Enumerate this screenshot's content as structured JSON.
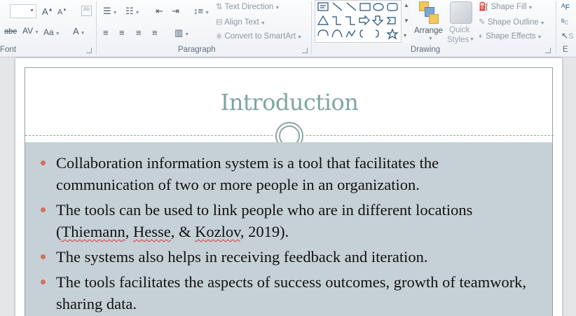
{
  "ribbon": {
    "groups": {
      "font": "Font",
      "paragraph": "Paragraph",
      "drawing": "Drawing"
    },
    "paragraph_buttons": {
      "text_direction": "Text Direction",
      "align_text": "Align Text",
      "convert_smartart": "Convert to SmartArt"
    },
    "drawing_buttons": {
      "arrange": "Arrange",
      "quick_styles_line1": "Quick",
      "quick_styles_line2": "Styles",
      "shape_fill": "Shape Fill",
      "shape_outline": "Shape Outline",
      "shape_effects": "Shape Effects"
    },
    "editing_partial": {
      "e_label": "E",
      "f_label": "F",
      "s_label": "S"
    }
  },
  "slide": {
    "title": "Introduction",
    "bullets": [
      {
        "parts": [
          {
            "t": "Collaboration information system is a tool that facilitates  the communication of two or more people in an organization."
          }
        ]
      },
      {
        "parts": [
          {
            "t": "The tools can be used to link  people who are in different locations ("
          },
          {
            "t": "Thiemann",
            "sq": true
          },
          {
            "t": ", "
          },
          {
            "t": "Hesse",
            "sq": true
          },
          {
            "t": ", & "
          },
          {
            "t": "Kozlov",
            "sq": true
          },
          {
            "t": ",  2019)."
          }
        ]
      },
      {
        "parts": [
          {
            "t": "The systems also helps in receiving  feedback and iteration."
          }
        ]
      },
      {
        "parts": [
          {
            "t": "The tools facilitates  the aspects of success outcomes, growth of teamwork, sharing data."
          }
        ]
      }
    ]
  },
  "colors": {
    "title": "#7fa5a2",
    "bullet": "#d46f5c",
    "body_panel": "#c5d0d7",
    "accent_ring": "#8fa5a5"
  }
}
